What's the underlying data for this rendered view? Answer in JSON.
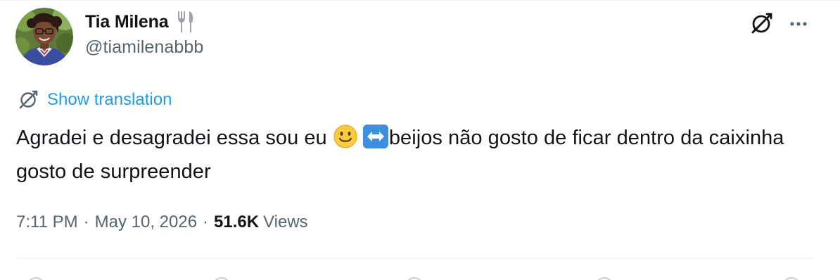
{
  "author": {
    "display_name": "Tia Milena",
    "name_emoji": "fork-and-knife-icon",
    "handle": "@tiamilenabbb"
  },
  "header_actions": {
    "grok_icon": "grok-icon",
    "more_icon": "more-horizontal-icon"
  },
  "translation": {
    "icon": "translation-icon",
    "label": "Show translation"
  },
  "tweet": {
    "text_part1": "Agradei e desagradei essa sou eu ",
    "emoji1": "slightly-smiling-face-icon",
    "emoji2": "left-right-arrow-icon",
    "text_part2": "beijos não gosto de ficar dentro da caixinha gosto de surpreender"
  },
  "meta": {
    "time": "7:11 PM",
    "separator": "·",
    "date": "May 10, 2026",
    "views_count": "51.6K",
    "views_label": "Views"
  },
  "colors": {
    "text_primary": "#0f1419",
    "text_secondary": "#536471",
    "link": "#1d9bf0",
    "divider": "#eff3f4"
  }
}
